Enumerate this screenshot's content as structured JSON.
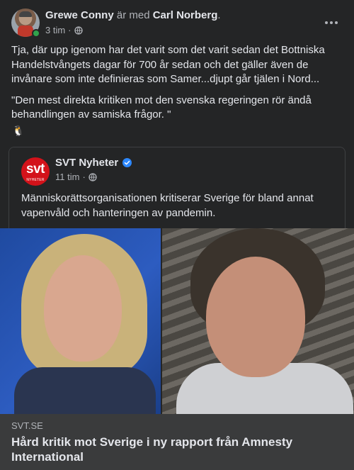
{
  "post": {
    "author": "Grewe Conny",
    "with_text": "är med",
    "tagged": "Carl Norberg",
    "tagged_suffix": ".",
    "time": "3 tim",
    "separator": "·",
    "paragraph1": "Tja, där upp igenom har det varit som det varit sedan det Bottniska Handelstvångets dagar för 700 år sedan och det gäller även de invånare som inte definieras som Samer...djupt går tjälen i Nord...",
    "paragraph2": "\"Den mest direkta kritiken mot den svenska regeringen rör ändå behandlingen av samiska frågor. \"",
    "emoji": "🐧"
  },
  "shared": {
    "logo_text": "svt",
    "logo_subtext": "NYHETER",
    "page_name": "SVT Nyheter",
    "time": "11 tim",
    "separator": "·",
    "text": "Människorättsorganisationen kritiserar Sverige för bland annat vapenvåld och hanteringen av pandemin."
  },
  "link": {
    "domain": "SVT.SE",
    "title": "Hård kritik mot Sverige i ny rapport från Amnesty International"
  },
  "colors": {
    "background": "#242526",
    "footer": "#3a3b3c",
    "verified": "#2d88ff",
    "svt_red": "#d3121a"
  },
  "icons": [
    "globe-icon",
    "more-options-icon",
    "verified-badge-icon",
    "penguin-icon"
  ]
}
